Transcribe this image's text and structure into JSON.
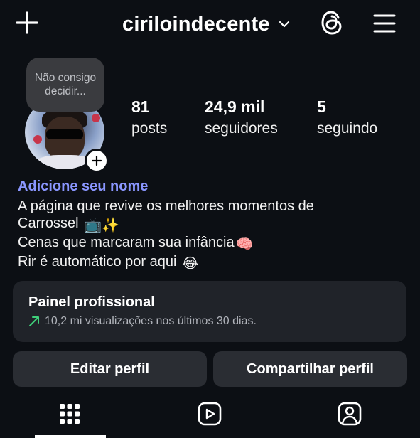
{
  "header": {
    "username": "ciriloindecente",
    "icons": [
      "plus-icon",
      "chevron-down-icon",
      "threads-icon",
      "hamburger-menu-icon"
    ]
  },
  "profile": {
    "note": "Não consigo decidir...",
    "stats": {
      "posts": {
        "value": "81",
        "label": "posts"
      },
      "followers": {
        "value": "24,9 mil",
        "label": "seguidores"
      },
      "following": {
        "value": "5",
        "label": "seguindo"
      }
    },
    "add_name_link": "Adicione seu nome",
    "bio": {
      "line1": "A página que revive os melhores momentos de",
      "line2": "Carrossel",
      "line2_emojis": "📺✨",
      "line3": "Cenas que marcaram sua infância",
      "line3_emoji": "🧠",
      "line4": "Rir é automático por aqui",
      "line4_emoji": "😂"
    }
  },
  "dashboard": {
    "title": "Painel profissional",
    "subtitle": "10,2 mi visualizações nos últimos 30 dias.",
    "trend_icon": "trending-up-icon",
    "trend_color": "#3fd07a"
  },
  "actions": {
    "edit": "Editar perfil",
    "share": "Compartilhar perfil"
  },
  "tabs": [
    {
      "name": "grid",
      "icon": "grid-icon",
      "active": true
    },
    {
      "name": "reels",
      "icon": "reels-icon",
      "active": false
    },
    {
      "name": "tagged",
      "icon": "tagged-person-icon",
      "active": false
    }
  ],
  "colors": {
    "background": "#0c0f14",
    "link": "#8a96ff",
    "card": "#202329",
    "button": "#2a2d33"
  }
}
